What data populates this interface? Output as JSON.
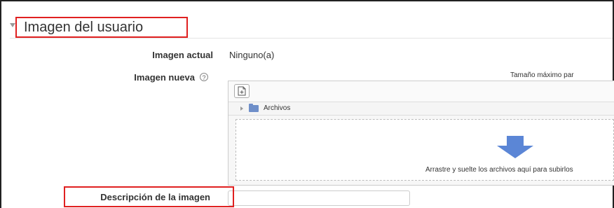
{
  "section": {
    "title": "Imagen del usuario"
  },
  "current_image": {
    "label": "Imagen actual",
    "value": "Ninguno(a)"
  },
  "new_image": {
    "label": "Imagen nueva",
    "help_icon": "help-icon",
    "help_glyph": "?",
    "max_size_text": "Tamaño máximo par"
  },
  "filepicker": {
    "add_icon": "add-file-icon",
    "path_label": "Archivos",
    "dropzone_text": "Arrastre y suelte los archivos aquí para subirlos"
  },
  "description": {
    "label": "Descripción de la imagen",
    "value": ""
  },
  "colors": {
    "highlight": "#e02020",
    "folder": "#6f8fc9",
    "arrow": "#5b86d6"
  }
}
